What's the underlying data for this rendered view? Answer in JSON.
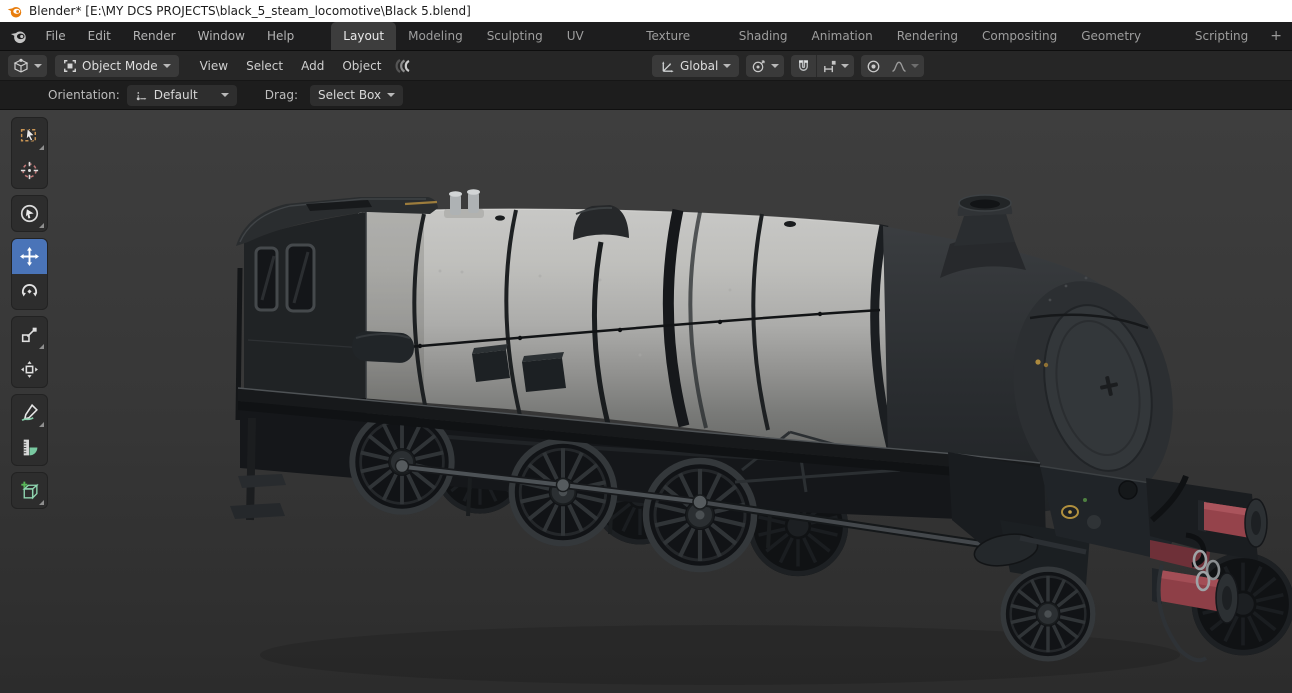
{
  "window": {
    "title": "Blender* [E:\\MY DCS PROJECTS\\black_5_steam_locomotive\\Black 5.blend]"
  },
  "menubar": {
    "menus": [
      "File",
      "Edit",
      "Render",
      "Window",
      "Help"
    ],
    "workspaces": [
      "Layout",
      "Modeling",
      "Sculpting",
      "UV Editing",
      "Texture Paint",
      "Shading",
      "Animation",
      "Rendering",
      "Compositing",
      "Geometry Nodes",
      "Scripting"
    ],
    "active_workspace": "Layout",
    "new_workspace_button": "+"
  },
  "viewport_header": {
    "mode_selector": "Object Mode",
    "menus": [
      "View",
      "Select",
      "Add",
      "Object"
    ],
    "transform_orientation": "Global"
  },
  "tool_settings": {
    "orientation_label": "Orientation:",
    "orientation_value": "Default",
    "drag_label": "Drag:",
    "drag_value": "Select Box"
  },
  "toolbar": {
    "active_tool": "move",
    "tools": [
      "select-box",
      "cursor",
      "select-circle",
      "move",
      "rotate",
      "scale",
      "transform",
      "annotate",
      "measure",
      "add-cube"
    ]
  },
  "viewport": {
    "content": "Black 5 steam locomotive 3D model, dark grey body, light grey boiler cladding, red front buffers"
  },
  "colors": {
    "active_tool_blue": "#4a74b8",
    "titlebar_bg": "#ffffff",
    "menubar_bg": "#1d1d1e",
    "header_bg": "#262626",
    "tool_settings_bg": "#1d1d1d",
    "viewport_bg_top": "#3e3e3e",
    "viewport_bg_bottom": "#2d2d2d",
    "boiler_grey": "#bfbfbc",
    "body_dark": "#202325",
    "buffer_red": "#95434b",
    "blender_orange": "#e87d0d",
    "annotate_mint": "#86ceaa"
  }
}
